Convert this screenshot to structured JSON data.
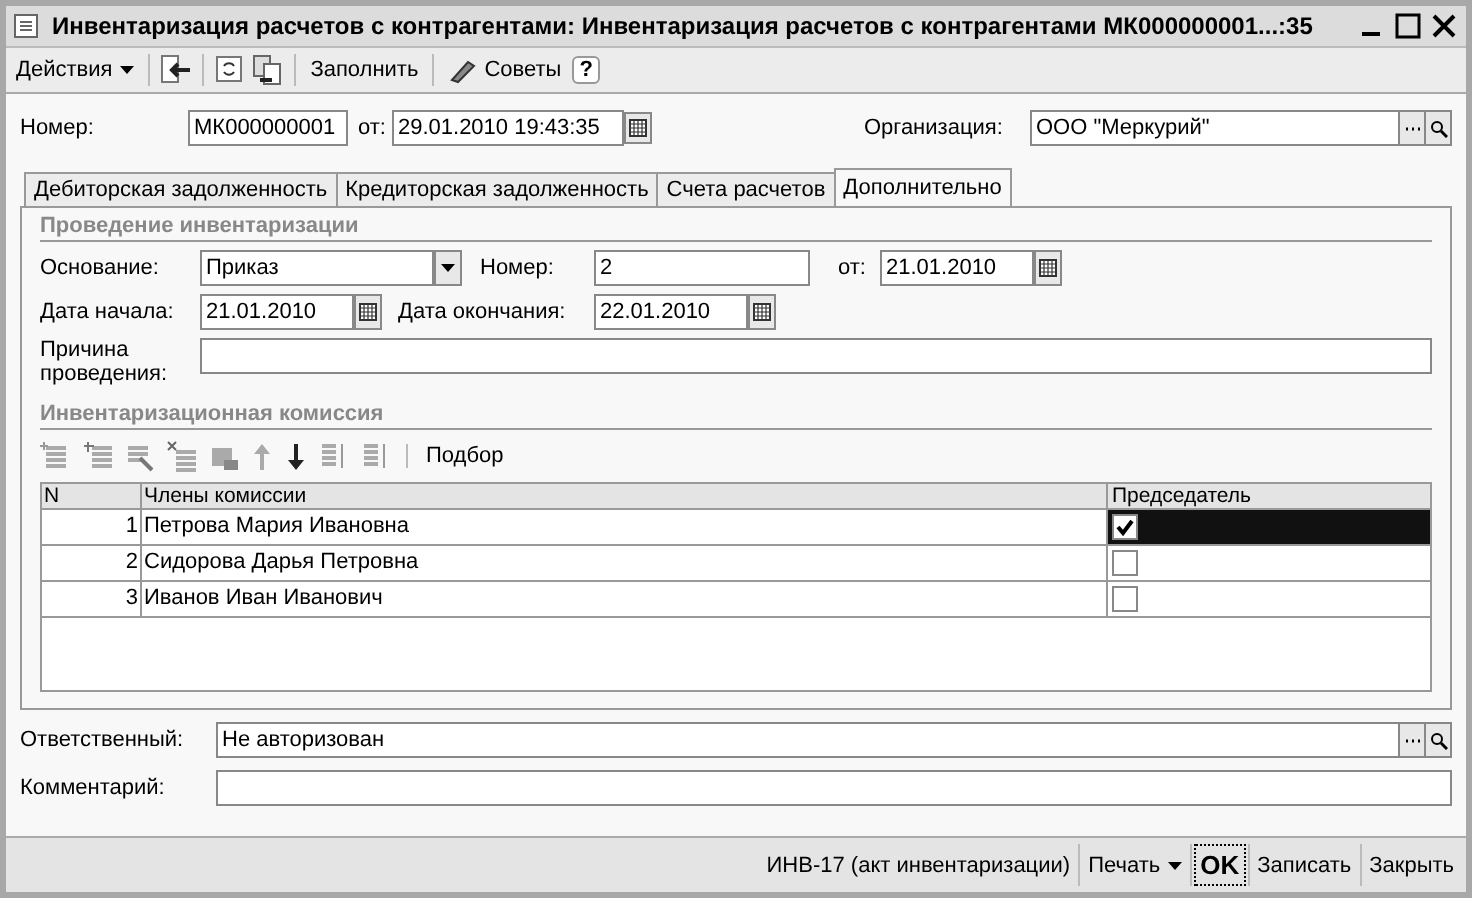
{
  "window": {
    "title": "Инвентаризация расчетов с контрагентами: Инвентаризация расчетов с контрагентами МК000000001...:35"
  },
  "toolbar": {
    "actions": "Действия",
    "fill": "Заполнить",
    "tips": "Советы",
    "help": "?"
  },
  "header": {
    "number_label": "Номер:",
    "number": "МК000000001",
    "date_label": "от:",
    "date": "29.01.2010 19:43:35",
    "org_label": "Организация:",
    "org": "ООО \"Меркурий\""
  },
  "tabs": [
    {
      "label": "Дебиторская задолженность",
      "selected": false
    },
    {
      "label": "Кредиторская задолженность",
      "selected": false
    },
    {
      "label": "Счета расчетов",
      "selected": false
    },
    {
      "label": "Дополнительно",
      "selected": true
    }
  ],
  "inventory": {
    "title": "Проведение инвентаризации",
    "basis_label": "Основание:",
    "basis": "Приказ",
    "num_label": "Номер:",
    "num": "2",
    "date_label": "от:",
    "date": "21.01.2010",
    "start_label": "Дата начала:",
    "start": "21.01.2010",
    "end_label": "Дата окончания:",
    "end": "22.01.2010",
    "reason_label": "Причина проведения:"
  },
  "commission": {
    "title": "Инвентаризационная комиссия",
    "pick": "Подбор",
    "columns": [
      "N",
      "Члены комиссии",
      "Председатель"
    ],
    "rows": [
      {
        "n": "1",
        "name": "Петрова  Мария Ивановна",
        "chairman": true,
        "selected": true
      },
      {
        "n": "2",
        "name": "Сидорова  Дарья Петровна",
        "chairman": false,
        "selected": false
      },
      {
        "n": "3",
        "name": "Иванов Иван Иванович",
        "chairman": false,
        "selected": false
      }
    ]
  },
  "responsible": {
    "label": "Ответственный:",
    "value": "Не авторизован"
  },
  "comment": {
    "label": "Комментарий:"
  },
  "footer": {
    "buttons": [
      {
        "label": "ИНВ-17 (акт инвентаризации)",
        "kind": "plain"
      },
      {
        "label": "Печать",
        "kind": "menu"
      },
      {
        "label": "OK",
        "kind": "default"
      },
      {
        "label": "Записать",
        "kind": "plain"
      },
      {
        "label": "Закрыть",
        "kind": "plain"
      }
    ]
  }
}
